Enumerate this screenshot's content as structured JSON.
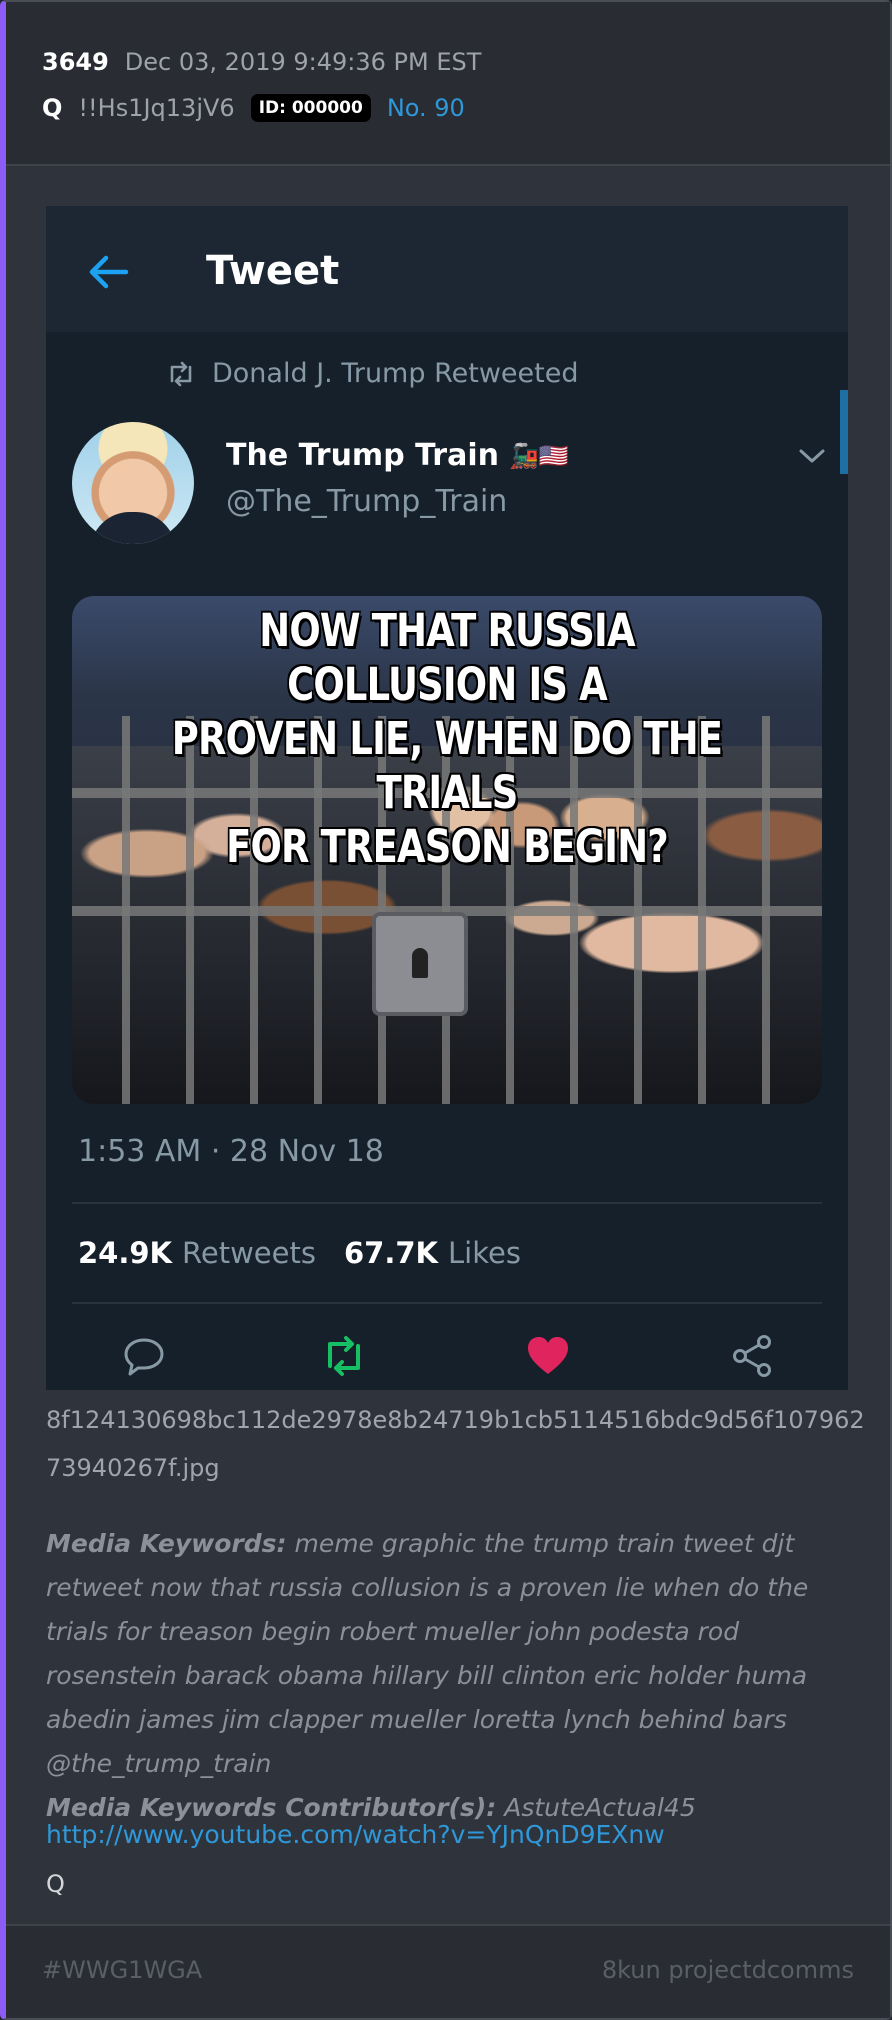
{
  "post": {
    "number": "3649",
    "date": "Dec 03, 2019 9:49:36 PM EST",
    "author": "Q",
    "tripcode": "!!Hs1Jq13jV6",
    "id_badge": "ID: 000000",
    "post_no": "No. 90"
  },
  "tweet": {
    "header_title": "Tweet",
    "retweeted_by": "Donald J. Trump Retweeted",
    "name": "The Trump Train",
    "name_emoji": "🚂🇺🇸",
    "handle": "@The_Trump_Train",
    "image_caption": "NOW THAT RUSSIA COLLUSION IS A\nPROVEN LIE, WHEN DO THE TRIALS\nFOR TREASON BEGIN?",
    "timestamp": "1:53 AM · 28 Nov 18",
    "retweets_value": "24.9K",
    "retweets_label": "Retweets",
    "likes_value": "67.7K",
    "likes_label": "Likes",
    "colors": {
      "bg": "#15202b",
      "retweet": "#17bf63",
      "like": "#e0245e",
      "link_blue": "#1da1f2"
    },
    "icons": [
      "back-arrow-icon",
      "retweet-icon",
      "chevron-down-icon",
      "reply-icon",
      "retweet-icon",
      "heart-icon",
      "share-icon"
    ]
  },
  "attachment": {
    "filename": "8f124130698bc112de2978e8b24719b1cb5114516bdc9d56f10796273940267f.jpg"
  },
  "keywords": {
    "label": "Media Keywords:",
    "text": "meme graphic the trump train tweet djt retweet now that russia collusion is a proven lie when do the trials for treason begin robert mueller john podesta rod rosenstein barack obama hillary bill clinton eric holder huma abedin james jim clapper mueller loretta lynch behind bars @the_trump_train",
    "contributor_label": "Media Keywords Contributor(s):",
    "contributor": "AstuteActual45"
  },
  "body": {
    "link": "http://www.youtube.com/watch?v=YJnQnD9EXnw",
    "signature": "Q"
  },
  "footer": {
    "hashtag": "#WWG1WGA",
    "source": "8kun projectdcomms"
  }
}
